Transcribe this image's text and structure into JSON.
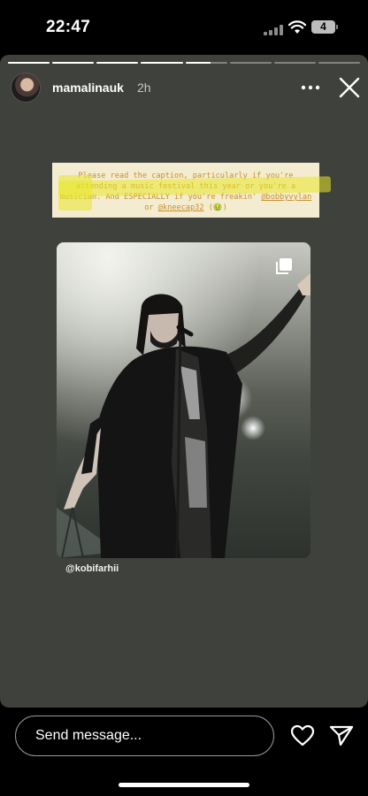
{
  "status_bar": {
    "time": "22:47",
    "battery": "4"
  },
  "story": {
    "progress_segments": [
      1,
      1,
      1,
      1,
      0.6,
      0,
      0,
      0
    ],
    "user": {
      "username": "mamalinauk",
      "age": "2h"
    },
    "caption": {
      "text_before": "Please read the caption, particularly if you're attending a music festival this year or you're a musician. And ESPECIALLY if you're freakin' ",
      "mention_1": "@bobbyvylan",
      "connector": " or ",
      "mention_2": "@kneecap32",
      "text_after": " (🤢)"
    },
    "photo_credit": "@kobifarhii"
  },
  "bottom_bar": {
    "message_placeholder": "Send message..."
  },
  "icons": {
    "more": "more-horizontal-icon",
    "close": "close-icon",
    "multi": "multiple-posts-icon",
    "heart": "heart-icon",
    "send": "send-paper-plane-icon",
    "wifi": "wifi-icon",
    "signal": "cellular-signal-icon"
  },
  "colors": {
    "story_background": "#3f413c",
    "caption_background": "#f4ecd0",
    "caption_text": "#c68f2c",
    "highlight": "#e8e828"
  }
}
